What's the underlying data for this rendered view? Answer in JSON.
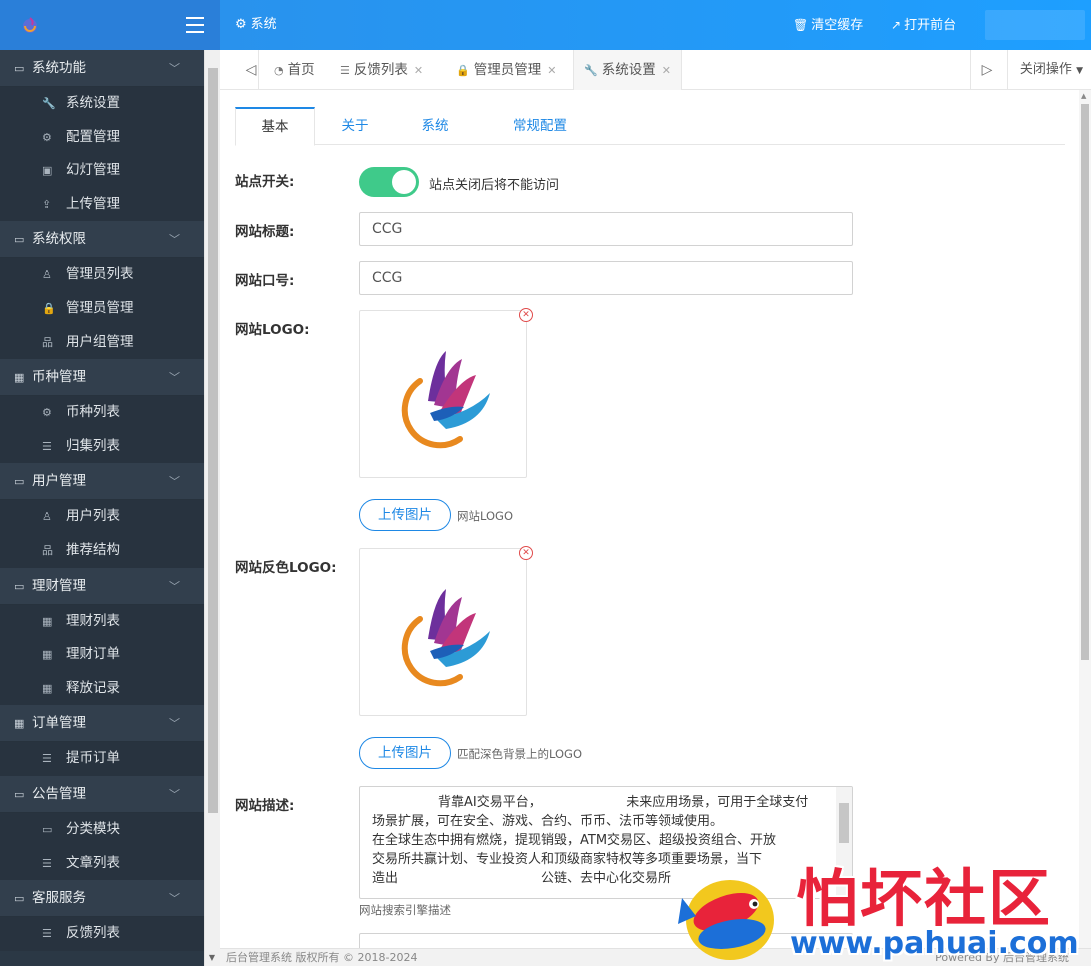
{
  "colors": {
    "topbar": "#1e9fff",
    "sidebar": "#2b3845",
    "accent": "#1e88e5",
    "switch_on": "#3fca8a",
    "danger": "#e04a4a",
    "watermark_red": "#e8233a",
    "watermark_blue": "#1c6fd8"
  },
  "header": {
    "module_icon": "gear-icon",
    "module_label": "系统",
    "clear_cache": {
      "icon": "trash-icon",
      "label": "清空缓存"
    },
    "open_frontend": {
      "icon": "external-link-icon",
      "label": "打开前台"
    }
  },
  "sidebar": {
    "groups": [
      {
        "label": "系统功能",
        "items": [
          {
            "icon": "wrench-icon",
            "label": "系统设置"
          },
          {
            "icon": "gears-icon",
            "label": "配置管理"
          },
          {
            "icon": "image-icon",
            "label": "幻灯管理"
          },
          {
            "icon": "upload-icon",
            "label": "上传管理"
          }
        ]
      },
      {
        "label": "系统权限",
        "items": [
          {
            "icon": "user-icon",
            "label": "管理员列表"
          },
          {
            "icon": "lock-icon",
            "label": "管理员管理"
          },
          {
            "icon": "sitemap-icon",
            "label": "用户组管理"
          }
        ]
      },
      {
        "label": "币种管理",
        "items": [
          {
            "icon": "gears-icon",
            "label": "币种列表"
          },
          {
            "icon": "list-icon",
            "label": "归集列表"
          }
        ]
      },
      {
        "label": "用户管理",
        "items": [
          {
            "icon": "user-icon",
            "label": "用户列表"
          },
          {
            "icon": "sitemap-icon",
            "label": "推荐结构"
          }
        ]
      },
      {
        "label": "理财管理",
        "items": [
          {
            "icon": "grid-icon",
            "label": "理财列表"
          },
          {
            "icon": "grid-icon",
            "label": "理财订单"
          },
          {
            "icon": "grid-icon",
            "label": "释放记录"
          }
        ]
      },
      {
        "label": "订单管理",
        "items": [
          {
            "icon": "list-icon",
            "label": "提币订单"
          }
        ]
      },
      {
        "label": "公告管理",
        "items": [
          {
            "icon": "inbox-icon",
            "label": "分类模块"
          },
          {
            "icon": "list-icon",
            "label": "文章列表"
          }
        ]
      },
      {
        "label": "客服服务",
        "items": [
          {
            "icon": "list-icon",
            "label": "反馈列表"
          }
        ]
      }
    ]
  },
  "tabs": {
    "items": [
      {
        "icon": "dashboard-icon",
        "label": "首页",
        "closable": false
      },
      {
        "icon": "list-icon",
        "label": "反馈列表",
        "closable": true
      },
      {
        "icon": "lock-icon",
        "label": "管理员管理",
        "closable": true
      },
      {
        "icon": "wrench-icon",
        "label": "系统设置",
        "closable": true,
        "active": true
      }
    ],
    "close_ops_label": "关闭操作"
  },
  "form": {
    "subtabs": [
      "基本",
      "关于",
      "系统",
      "常规配置"
    ],
    "site_switch": {
      "label": "站点开关:",
      "on": true,
      "hint": "站点关闭后将不能访问"
    },
    "site_title": {
      "label": "网站标题:",
      "value": "CCG"
    },
    "site_slogan": {
      "label": "网站口号:",
      "value": "CCG"
    },
    "site_logo": {
      "label": "网站LOGO:",
      "upload_label": "上传图片",
      "hint": "网站LOGO"
    },
    "site_logo_inverse": {
      "label": "网站反色LOGO:",
      "upload_label": "上传图片",
      "hint": "匹配深色背景上的LOGO"
    },
    "site_desc": {
      "label": "网站描述:",
      "lines": [
        "背靠AI交易平台，　　　　　　　未来应用场景，可用于全球支付",
        "场景扩展，可在安全、游戏、合约、币币、法币等领域使用。",
        "在全球生态中拥有燃烧，提现销毁，ATM交易区、超级投资组合、开放",
        "交易所共赢计划、专业投资人和顶级商家特权等多项重要场景，当下",
        "造出　　　　　　　　　　　公链、去中心化交易所"
      ],
      "hint": "网站搜索引擎描述"
    }
  },
  "footer": {
    "left": "后台管理系统 版权所有 © 2018-2024",
    "right": "Powered By 后台管理系统"
  },
  "watermark": {
    "title": "怕坏社区",
    "url": "www.pahuai.com"
  }
}
